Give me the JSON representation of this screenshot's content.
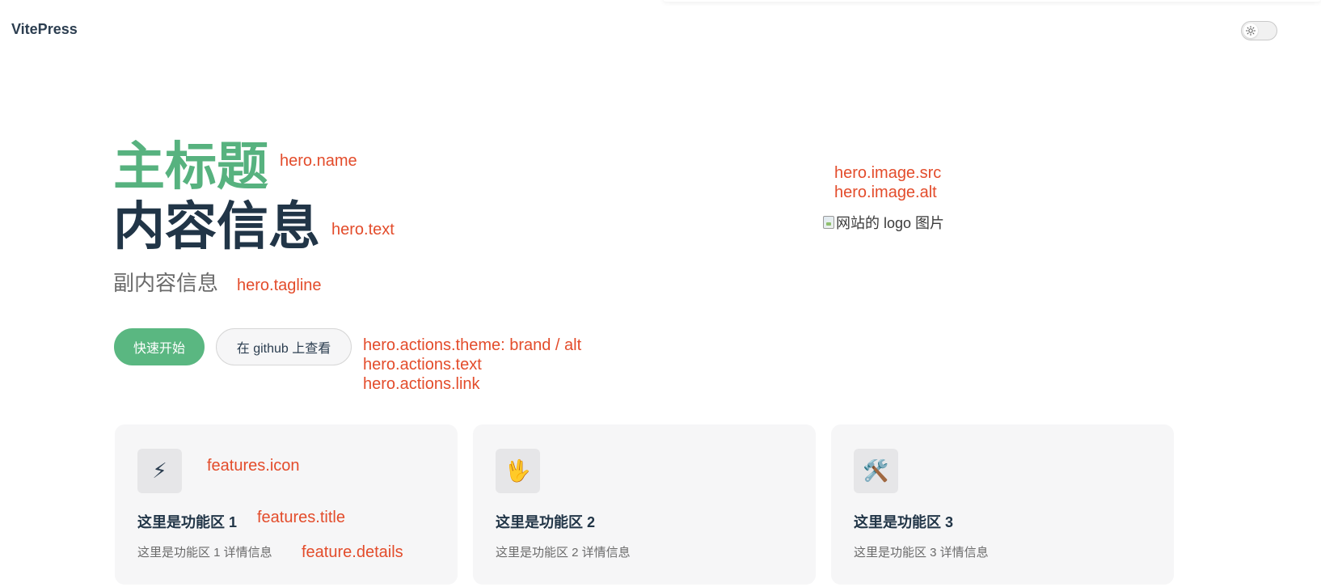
{
  "nav": {
    "site_title": "VitePress"
  },
  "hero": {
    "name": "主标题",
    "text": "内容信息",
    "tagline": "副内容信息",
    "image_alt": "网站的 logo 图片",
    "actions": [
      {
        "label": "快速开始",
        "theme": "brand"
      },
      {
        "label": "在 github 上查看",
        "theme": "alt"
      }
    ]
  },
  "features": [
    {
      "icon": "⚡",
      "icon_name": "lightning-icon",
      "title": "这里是功能区 1",
      "details": "这里是功能区 1 详情信息"
    },
    {
      "icon": "🖖",
      "icon_name": "vulcan-salute-icon",
      "title": "这里是功能区 2",
      "details": "这里是功能区 2 详情信息"
    },
    {
      "icon": "🛠️",
      "icon_name": "hammer-wrench-icon",
      "title": "这里是功能区 3",
      "details": "这里是功能区 3 详情信息"
    }
  ],
  "annotations": {
    "hero_name": "hero.name",
    "hero_text": "hero.text",
    "hero_tagline": "hero.tagline",
    "hero_image_src": "hero.image.src",
    "hero_image_alt": "hero.image.alt",
    "actions_theme": "hero.actions.theme: brand / alt",
    "actions_text": "hero.actions.text",
    "actions_link": "hero.actions.link",
    "features_icon": "features.icon",
    "features_title": "features.title",
    "feature_details": "feature.details"
  },
  "colors": {
    "brand": "#5ab781",
    "hero_name": "#57b27f",
    "annotation": "#e34c2b",
    "feature_bg": "#f6f6f7"
  }
}
